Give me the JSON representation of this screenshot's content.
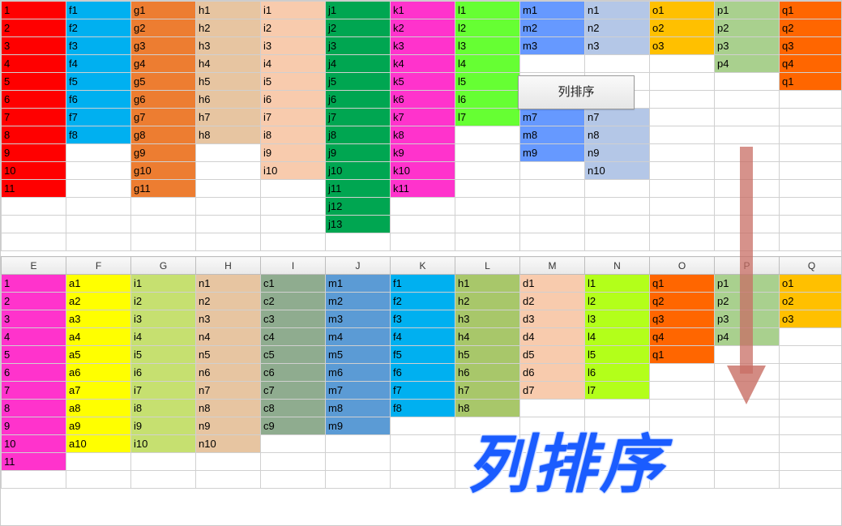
{
  "button_label": "列排序",
  "big_text": "列排序",
  "headers": [
    "E",
    "F",
    "G",
    "H",
    "I",
    "J",
    "K",
    "L",
    "M",
    "N",
    "O",
    "P",
    "Q"
  ],
  "grid1": {
    "rows": 14,
    "cols": 13,
    "cells": [
      {
        "r": 0,
        "c": 0,
        "v": "1",
        "cls": "c-red"
      },
      {
        "r": 0,
        "c": 1,
        "v": "f1",
        "cls": "c-sky"
      },
      {
        "r": 0,
        "c": 2,
        "v": "g1",
        "cls": "c-orange"
      },
      {
        "r": 0,
        "c": 3,
        "v": "h1",
        "cls": "c-tan"
      },
      {
        "r": 0,
        "c": 4,
        "v": "i1",
        "cls": "c-pink"
      },
      {
        "r": 0,
        "c": 5,
        "v": "j1",
        "cls": "c-green"
      },
      {
        "r": 0,
        "c": 6,
        "v": "k1",
        "cls": "c-magenta"
      },
      {
        "r": 0,
        "c": 7,
        "v": "l1",
        "cls": "c-lime"
      },
      {
        "r": 0,
        "c": 8,
        "v": "m1",
        "cls": "c-blue"
      },
      {
        "r": 0,
        "c": 9,
        "v": "n1",
        "cls": "c-lblue"
      },
      {
        "r": 0,
        "c": 10,
        "v": "o1",
        "cls": "c-yorange"
      },
      {
        "r": 0,
        "c": 11,
        "v": "p1",
        "cls": "c-lgreen"
      },
      {
        "r": 0,
        "c": 12,
        "v": "q1",
        "cls": "c-dorange"
      },
      {
        "r": 1,
        "c": 0,
        "v": "2",
        "cls": "c-red"
      },
      {
        "r": 1,
        "c": 1,
        "v": "f2",
        "cls": "c-sky"
      },
      {
        "r": 1,
        "c": 2,
        "v": "g2",
        "cls": "c-orange"
      },
      {
        "r": 1,
        "c": 3,
        "v": "h2",
        "cls": "c-tan"
      },
      {
        "r": 1,
        "c": 4,
        "v": "i2",
        "cls": "c-pink"
      },
      {
        "r": 1,
        "c": 5,
        "v": "j2",
        "cls": "c-green"
      },
      {
        "r": 1,
        "c": 6,
        "v": "k2",
        "cls": "c-magenta"
      },
      {
        "r": 1,
        "c": 7,
        "v": "l2",
        "cls": "c-lime"
      },
      {
        "r": 1,
        "c": 8,
        "v": "m2",
        "cls": "c-blue"
      },
      {
        "r": 1,
        "c": 9,
        "v": "n2",
        "cls": "c-lblue"
      },
      {
        "r": 1,
        "c": 10,
        "v": "o2",
        "cls": "c-yorange"
      },
      {
        "r": 1,
        "c": 11,
        "v": "p2",
        "cls": "c-lgreen"
      },
      {
        "r": 1,
        "c": 12,
        "v": "q2",
        "cls": "c-dorange"
      },
      {
        "r": 2,
        "c": 0,
        "v": "3",
        "cls": "c-red"
      },
      {
        "r": 2,
        "c": 1,
        "v": "f3",
        "cls": "c-sky"
      },
      {
        "r": 2,
        "c": 2,
        "v": "g3",
        "cls": "c-orange"
      },
      {
        "r": 2,
        "c": 3,
        "v": "h3",
        "cls": "c-tan"
      },
      {
        "r": 2,
        "c": 4,
        "v": "i3",
        "cls": "c-pink"
      },
      {
        "r": 2,
        "c": 5,
        "v": "j3",
        "cls": "c-green"
      },
      {
        "r": 2,
        "c": 6,
        "v": "k3",
        "cls": "c-magenta"
      },
      {
        "r": 2,
        "c": 7,
        "v": "l3",
        "cls": "c-lime"
      },
      {
        "r": 2,
        "c": 8,
        "v": "m3",
        "cls": "c-blue"
      },
      {
        "r": 2,
        "c": 9,
        "v": "n3",
        "cls": "c-lblue"
      },
      {
        "r": 2,
        "c": 10,
        "v": "o3",
        "cls": "c-yorange"
      },
      {
        "r": 2,
        "c": 11,
        "v": "p3",
        "cls": "c-lgreen"
      },
      {
        "r": 2,
        "c": 12,
        "v": "q3",
        "cls": "c-dorange"
      },
      {
        "r": 3,
        "c": 0,
        "v": "4",
        "cls": "c-red"
      },
      {
        "r": 3,
        "c": 1,
        "v": "f4",
        "cls": "c-sky"
      },
      {
        "r": 3,
        "c": 2,
        "v": "g4",
        "cls": "c-orange"
      },
      {
        "r": 3,
        "c": 3,
        "v": "h4",
        "cls": "c-tan"
      },
      {
        "r": 3,
        "c": 4,
        "v": "i4",
        "cls": "c-pink"
      },
      {
        "r": 3,
        "c": 5,
        "v": "j4",
        "cls": "c-green"
      },
      {
        "r": 3,
        "c": 6,
        "v": "k4",
        "cls": "c-magenta"
      },
      {
        "r": 3,
        "c": 7,
        "v": "l4",
        "cls": "c-lime"
      },
      {
        "r": 3,
        "c": 11,
        "v": "p4",
        "cls": "c-lgreen"
      },
      {
        "r": 3,
        "c": 12,
        "v": "q4",
        "cls": "c-dorange"
      },
      {
        "r": 4,
        "c": 0,
        "v": "5",
        "cls": "c-red"
      },
      {
        "r": 4,
        "c": 1,
        "v": "f5",
        "cls": "c-sky"
      },
      {
        "r": 4,
        "c": 2,
        "v": "g5",
        "cls": "c-orange"
      },
      {
        "r": 4,
        "c": 3,
        "v": "h5",
        "cls": "c-tan"
      },
      {
        "r": 4,
        "c": 4,
        "v": "i5",
        "cls": "c-pink"
      },
      {
        "r": 4,
        "c": 5,
        "v": "j5",
        "cls": "c-green"
      },
      {
        "r": 4,
        "c": 6,
        "v": "k5",
        "cls": "c-magenta"
      },
      {
        "r": 4,
        "c": 7,
        "v": "l5",
        "cls": "c-lime"
      },
      {
        "r": 4,
        "c": 12,
        "v": "q1",
        "cls": "c-dorange"
      },
      {
        "r": 5,
        "c": 0,
        "v": "6",
        "cls": "c-red"
      },
      {
        "r": 5,
        "c": 1,
        "v": "f6",
        "cls": "c-sky"
      },
      {
        "r": 5,
        "c": 2,
        "v": "g6",
        "cls": "c-orange"
      },
      {
        "r": 5,
        "c": 3,
        "v": "h6",
        "cls": "c-tan"
      },
      {
        "r": 5,
        "c": 4,
        "v": "i6",
        "cls": "c-pink"
      },
      {
        "r": 5,
        "c": 5,
        "v": "j6",
        "cls": "c-green"
      },
      {
        "r": 5,
        "c": 6,
        "v": "k6",
        "cls": "c-magenta"
      },
      {
        "r": 5,
        "c": 7,
        "v": "l6",
        "cls": "c-lime"
      },
      {
        "r": 6,
        "c": 0,
        "v": "7",
        "cls": "c-red"
      },
      {
        "r": 6,
        "c": 1,
        "v": "f7",
        "cls": "c-sky"
      },
      {
        "r": 6,
        "c": 2,
        "v": "g7",
        "cls": "c-orange"
      },
      {
        "r": 6,
        "c": 3,
        "v": "h7",
        "cls": "c-tan"
      },
      {
        "r": 6,
        "c": 4,
        "v": "i7",
        "cls": "c-pink"
      },
      {
        "r": 6,
        "c": 5,
        "v": "j7",
        "cls": "c-green"
      },
      {
        "r": 6,
        "c": 6,
        "v": "k7",
        "cls": "c-magenta"
      },
      {
        "r": 6,
        "c": 7,
        "v": "l7",
        "cls": "c-lime"
      },
      {
        "r": 6,
        "c": 8,
        "v": "m7",
        "cls": "c-blue"
      },
      {
        "r": 6,
        "c": 9,
        "v": "n7",
        "cls": "c-lblue"
      },
      {
        "r": 7,
        "c": 0,
        "v": "8",
        "cls": "c-red"
      },
      {
        "r": 7,
        "c": 1,
        "v": "f8",
        "cls": "c-sky"
      },
      {
        "r": 7,
        "c": 2,
        "v": "g8",
        "cls": "c-orange"
      },
      {
        "r": 7,
        "c": 3,
        "v": "h8",
        "cls": "c-tan"
      },
      {
        "r": 7,
        "c": 4,
        "v": "i8",
        "cls": "c-pink"
      },
      {
        "r": 7,
        "c": 5,
        "v": "j8",
        "cls": "c-green"
      },
      {
        "r": 7,
        "c": 6,
        "v": "k8",
        "cls": "c-magenta"
      },
      {
        "r": 7,
        "c": 8,
        "v": "m8",
        "cls": "c-blue"
      },
      {
        "r": 7,
        "c": 9,
        "v": "n8",
        "cls": "c-lblue"
      },
      {
        "r": 8,
        "c": 0,
        "v": "9",
        "cls": "c-red"
      },
      {
        "r": 8,
        "c": 2,
        "v": "g9",
        "cls": "c-orange"
      },
      {
        "r": 8,
        "c": 4,
        "v": "i9",
        "cls": "c-pink"
      },
      {
        "r": 8,
        "c": 5,
        "v": "j9",
        "cls": "c-green"
      },
      {
        "r": 8,
        "c": 6,
        "v": "k9",
        "cls": "c-magenta"
      },
      {
        "r": 8,
        "c": 8,
        "v": "m9",
        "cls": "c-blue"
      },
      {
        "r": 8,
        "c": 9,
        "v": "n9",
        "cls": "c-lblue"
      },
      {
        "r": 9,
        "c": 0,
        "v": "10",
        "cls": "c-red"
      },
      {
        "r": 9,
        "c": 2,
        "v": "g10",
        "cls": "c-orange"
      },
      {
        "r": 9,
        "c": 4,
        "v": "i10",
        "cls": "c-pink"
      },
      {
        "r": 9,
        "c": 5,
        "v": "j10",
        "cls": "c-green"
      },
      {
        "r": 9,
        "c": 6,
        "v": "k10",
        "cls": "c-magenta"
      },
      {
        "r": 9,
        "c": 9,
        "v": "n10",
        "cls": "c-lblue"
      },
      {
        "r": 10,
        "c": 0,
        "v": "11",
        "cls": "c-red"
      },
      {
        "r": 10,
        "c": 2,
        "v": "g11",
        "cls": "c-orange"
      },
      {
        "r": 10,
        "c": 5,
        "v": "j11",
        "cls": "c-green"
      },
      {
        "r": 10,
        "c": 6,
        "v": "k11",
        "cls": "c-magenta"
      },
      {
        "r": 11,
        "c": 5,
        "v": "j12",
        "cls": "c-green"
      },
      {
        "r": 12,
        "c": 5,
        "v": "j13",
        "cls": "c-green"
      }
    ]
  },
  "grid2": {
    "rows": 12,
    "cols": 13,
    "cells": [
      {
        "r": 0,
        "c": 0,
        "v": "1",
        "cls": "c-magenta"
      },
      {
        "r": 0,
        "c": 1,
        "v": "a1",
        "cls": "c-yellow"
      },
      {
        "r": 0,
        "c": 2,
        "v": "i1",
        "cls": "c-ygreen"
      },
      {
        "r": 0,
        "c": 3,
        "v": "n1",
        "cls": "c-tan"
      },
      {
        "r": 0,
        "c": 4,
        "v": "c1",
        "cls": "c-sage"
      },
      {
        "r": 0,
        "c": 5,
        "v": "m1",
        "cls": "c-teal"
      },
      {
        "r": 0,
        "c": 6,
        "v": "f1",
        "cls": "c-sky"
      },
      {
        "r": 0,
        "c": 7,
        "v": "h1",
        "cls": "c-olive"
      },
      {
        "r": 0,
        "c": 8,
        "v": "d1",
        "cls": "c-pink"
      },
      {
        "r": 0,
        "c": 9,
        "v": "l1",
        "cls": "c-ygreen2"
      },
      {
        "r": 0,
        "c": 10,
        "v": "q1",
        "cls": "c-dorange"
      },
      {
        "r": 0,
        "c": 11,
        "v": "p1",
        "cls": "c-lgreen"
      },
      {
        "r": 0,
        "c": 12,
        "v": "o1",
        "cls": "c-yorange"
      },
      {
        "r": 1,
        "c": 0,
        "v": "2",
        "cls": "c-magenta"
      },
      {
        "r": 1,
        "c": 1,
        "v": "a2",
        "cls": "c-yellow"
      },
      {
        "r": 1,
        "c": 2,
        "v": "i2",
        "cls": "c-ygreen"
      },
      {
        "r": 1,
        "c": 3,
        "v": "n2",
        "cls": "c-tan"
      },
      {
        "r": 1,
        "c": 4,
        "v": "c2",
        "cls": "c-sage"
      },
      {
        "r": 1,
        "c": 5,
        "v": "m2",
        "cls": "c-teal"
      },
      {
        "r": 1,
        "c": 6,
        "v": "f2",
        "cls": "c-sky"
      },
      {
        "r": 1,
        "c": 7,
        "v": "h2",
        "cls": "c-olive"
      },
      {
        "r": 1,
        "c": 8,
        "v": "d2",
        "cls": "c-pink"
      },
      {
        "r": 1,
        "c": 9,
        "v": "l2",
        "cls": "c-ygreen2"
      },
      {
        "r": 1,
        "c": 10,
        "v": "q2",
        "cls": "c-dorange"
      },
      {
        "r": 1,
        "c": 11,
        "v": "p2",
        "cls": "c-lgreen"
      },
      {
        "r": 1,
        "c": 12,
        "v": "o2",
        "cls": "c-yorange"
      },
      {
        "r": 2,
        "c": 0,
        "v": "3",
        "cls": "c-magenta"
      },
      {
        "r": 2,
        "c": 1,
        "v": "a3",
        "cls": "c-yellow"
      },
      {
        "r": 2,
        "c": 2,
        "v": "i3",
        "cls": "c-ygreen"
      },
      {
        "r": 2,
        "c": 3,
        "v": "n3",
        "cls": "c-tan"
      },
      {
        "r": 2,
        "c": 4,
        "v": "c3",
        "cls": "c-sage"
      },
      {
        "r": 2,
        "c": 5,
        "v": "m3",
        "cls": "c-teal"
      },
      {
        "r": 2,
        "c": 6,
        "v": "f3",
        "cls": "c-sky"
      },
      {
        "r": 2,
        "c": 7,
        "v": "h3",
        "cls": "c-olive"
      },
      {
        "r": 2,
        "c": 8,
        "v": "d3",
        "cls": "c-pink"
      },
      {
        "r": 2,
        "c": 9,
        "v": "l3",
        "cls": "c-ygreen2"
      },
      {
        "r": 2,
        "c": 10,
        "v": "q3",
        "cls": "c-dorange"
      },
      {
        "r": 2,
        "c": 11,
        "v": "p3",
        "cls": "c-lgreen"
      },
      {
        "r": 2,
        "c": 12,
        "v": "o3",
        "cls": "c-yorange"
      },
      {
        "r": 3,
        "c": 0,
        "v": "4",
        "cls": "c-magenta"
      },
      {
        "r": 3,
        "c": 1,
        "v": "a4",
        "cls": "c-yellow"
      },
      {
        "r": 3,
        "c": 2,
        "v": "i4",
        "cls": "c-ygreen"
      },
      {
        "r": 3,
        "c": 3,
        "v": "n4",
        "cls": "c-tan"
      },
      {
        "r": 3,
        "c": 4,
        "v": "c4",
        "cls": "c-sage"
      },
      {
        "r": 3,
        "c": 5,
        "v": "m4",
        "cls": "c-teal"
      },
      {
        "r": 3,
        "c": 6,
        "v": "f4",
        "cls": "c-sky"
      },
      {
        "r": 3,
        "c": 7,
        "v": "h4",
        "cls": "c-olive"
      },
      {
        "r": 3,
        "c": 8,
        "v": "d4",
        "cls": "c-pink"
      },
      {
        "r": 3,
        "c": 9,
        "v": "l4",
        "cls": "c-ygreen2"
      },
      {
        "r": 3,
        "c": 10,
        "v": "q4",
        "cls": "c-dorange"
      },
      {
        "r": 3,
        "c": 11,
        "v": "p4",
        "cls": "c-lgreen"
      },
      {
        "r": 4,
        "c": 0,
        "v": "5",
        "cls": "c-magenta"
      },
      {
        "r": 4,
        "c": 1,
        "v": "a5",
        "cls": "c-yellow"
      },
      {
        "r": 4,
        "c": 2,
        "v": "i5",
        "cls": "c-ygreen"
      },
      {
        "r": 4,
        "c": 3,
        "v": "n5",
        "cls": "c-tan"
      },
      {
        "r": 4,
        "c": 4,
        "v": "c5",
        "cls": "c-sage"
      },
      {
        "r": 4,
        "c": 5,
        "v": "m5",
        "cls": "c-teal"
      },
      {
        "r": 4,
        "c": 6,
        "v": "f5",
        "cls": "c-sky"
      },
      {
        "r": 4,
        "c": 7,
        "v": "h5",
        "cls": "c-olive"
      },
      {
        "r": 4,
        "c": 8,
        "v": "d5",
        "cls": "c-pink"
      },
      {
        "r": 4,
        "c": 9,
        "v": "l5",
        "cls": "c-ygreen2"
      },
      {
        "r": 4,
        "c": 10,
        "v": "q1",
        "cls": "c-dorange"
      },
      {
        "r": 5,
        "c": 0,
        "v": "6",
        "cls": "c-magenta"
      },
      {
        "r": 5,
        "c": 1,
        "v": "a6",
        "cls": "c-yellow"
      },
      {
        "r": 5,
        "c": 2,
        "v": "i6",
        "cls": "c-ygreen"
      },
      {
        "r": 5,
        "c": 3,
        "v": "n6",
        "cls": "c-tan"
      },
      {
        "r": 5,
        "c": 4,
        "v": "c6",
        "cls": "c-sage"
      },
      {
        "r": 5,
        "c": 5,
        "v": "m6",
        "cls": "c-teal"
      },
      {
        "r": 5,
        "c": 6,
        "v": "f6",
        "cls": "c-sky"
      },
      {
        "r": 5,
        "c": 7,
        "v": "h6",
        "cls": "c-olive"
      },
      {
        "r": 5,
        "c": 8,
        "v": "d6",
        "cls": "c-pink"
      },
      {
        "r": 5,
        "c": 9,
        "v": "l6",
        "cls": "c-ygreen2"
      },
      {
        "r": 6,
        "c": 0,
        "v": "7",
        "cls": "c-magenta"
      },
      {
        "r": 6,
        "c": 1,
        "v": "a7",
        "cls": "c-yellow"
      },
      {
        "r": 6,
        "c": 2,
        "v": "i7",
        "cls": "c-ygreen"
      },
      {
        "r": 6,
        "c": 3,
        "v": "n7",
        "cls": "c-tan"
      },
      {
        "r": 6,
        "c": 4,
        "v": "c7",
        "cls": "c-sage"
      },
      {
        "r": 6,
        "c": 5,
        "v": "m7",
        "cls": "c-teal"
      },
      {
        "r": 6,
        "c": 6,
        "v": "f7",
        "cls": "c-sky"
      },
      {
        "r": 6,
        "c": 7,
        "v": "h7",
        "cls": "c-olive"
      },
      {
        "r": 6,
        "c": 8,
        "v": "d7",
        "cls": "c-pink"
      },
      {
        "r": 6,
        "c": 9,
        "v": "l7",
        "cls": "c-ygreen2"
      },
      {
        "r": 7,
        "c": 0,
        "v": "8",
        "cls": "c-magenta"
      },
      {
        "r": 7,
        "c": 1,
        "v": "a8",
        "cls": "c-yellow"
      },
      {
        "r": 7,
        "c": 2,
        "v": "i8",
        "cls": "c-ygreen"
      },
      {
        "r": 7,
        "c": 3,
        "v": "n8",
        "cls": "c-tan"
      },
      {
        "r": 7,
        "c": 4,
        "v": "c8",
        "cls": "c-sage"
      },
      {
        "r": 7,
        "c": 5,
        "v": "m8",
        "cls": "c-teal"
      },
      {
        "r": 7,
        "c": 6,
        "v": "f8",
        "cls": "c-sky"
      },
      {
        "r": 7,
        "c": 7,
        "v": "h8",
        "cls": "c-olive"
      },
      {
        "r": 8,
        "c": 0,
        "v": "9",
        "cls": "c-magenta"
      },
      {
        "r": 8,
        "c": 1,
        "v": "a9",
        "cls": "c-yellow"
      },
      {
        "r": 8,
        "c": 2,
        "v": "i9",
        "cls": "c-ygreen"
      },
      {
        "r": 8,
        "c": 3,
        "v": "n9",
        "cls": "c-tan"
      },
      {
        "r": 8,
        "c": 4,
        "v": "c9",
        "cls": "c-sage"
      },
      {
        "r": 8,
        "c": 5,
        "v": "m9",
        "cls": "c-teal"
      },
      {
        "r": 9,
        "c": 0,
        "v": "10",
        "cls": "c-magenta"
      },
      {
        "r": 9,
        "c": 1,
        "v": "a10",
        "cls": "c-yellow"
      },
      {
        "r": 9,
        "c": 2,
        "v": "i10",
        "cls": "c-ygreen"
      },
      {
        "r": 9,
        "c": 3,
        "v": "n10",
        "cls": "c-tan"
      },
      {
        "r": 10,
        "c": 0,
        "v": "11",
        "cls": "c-magenta"
      }
    ]
  }
}
